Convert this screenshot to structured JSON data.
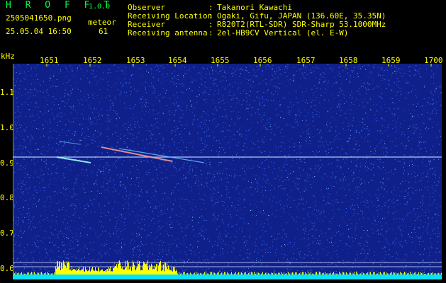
{
  "app": {
    "title": "H R O F F T",
    "version": "1.0.0"
  },
  "file": {
    "name": "2505041650.png",
    "datetime": "25.05.04 16:50"
  },
  "meteor": {
    "label": "meteor",
    "count": "61"
  },
  "info": [
    {
      "label": "Observer",
      "sep": ":",
      "value": "Takanori Kawachi"
    },
    {
      "label": "Receiving Location",
      "sep": ":",
      "value": "Ogaki, Gifu, JAPAN (136.60E, 35.35N)"
    },
    {
      "label": "Receiver",
      "sep": ":",
      "value": "R820T2(RTL-SDR) SDR-Sharp 53.1000MHz"
    },
    {
      "label": "Receiving antenna",
      "sep": ":",
      "value": "2el-HB9CV Vertical (el. E-W)"
    }
  ],
  "axis": {
    "y_unit": "kHz",
    "x_ticks": [
      "1651",
      "1652",
      "1653",
      "1654",
      "1655",
      "1656",
      "1657",
      "1658",
      "1659",
      "1700"
    ],
    "y_ticks": [
      "1.1",
      "1.0",
      "0.9",
      "0.8",
      "0.7",
      "0.6"
    ]
  },
  "colors": {
    "background": "#10208a",
    "noise": "#3a6cff",
    "trace": "#cfe8ff",
    "band": "#00e5ff",
    "bars": "#ffff00"
  }
}
